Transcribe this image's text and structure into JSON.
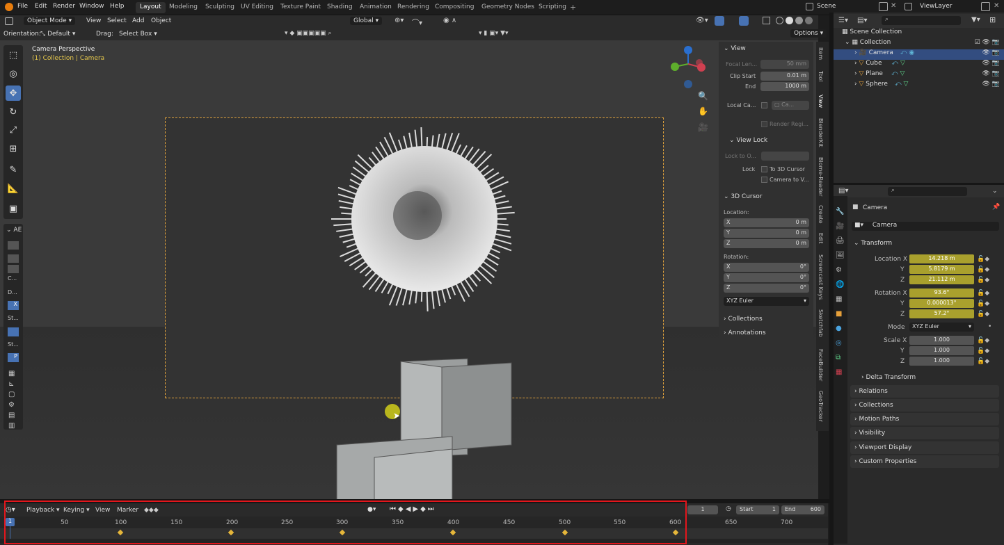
{
  "menubar": {
    "menus": [
      "File",
      "Edit",
      "Render",
      "Window",
      "Help"
    ],
    "workspaces": [
      "Layout",
      "Modeling",
      "Sculpting",
      "UV Editing",
      "Texture Paint",
      "Shading",
      "Animation",
      "Rendering",
      "Compositing",
      "Geometry Nodes",
      "Scripting"
    ],
    "active_workspace": "Layout",
    "scene": "Scene",
    "view_layer": "ViewLayer"
  },
  "viewport_header": {
    "mode": "Object Mode",
    "menus": [
      "View",
      "Select",
      "Add",
      "Object"
    ],
    "transform": "Global",
    "orientation_label": "Orientation:",
    "orientation_value": "Default",
    "drag_label": "Drag:",
    "drag_value": "Select Box",
    "options": "Options"
  },
  "viewport": {
    "title": "Camera Perspective",
    "subtitle": "(1) Collection | Camera",
    "ae_label": "AE",
    "side_labels": [
      "C...",
      "D...",
      "X",
      "St...",
      "St...",
      "P"
    ]
  },
  "npanel": {
    "view_section": "View",
    "focal_label": "Focal Len...",
    "focal_value": "50 mm",
    "clip_start_label": "Clip Start",
    "clip_start_value": "0.01 m",
    "end_label": "End",
    "end_value": "1000 m",
    "local_cam_label": "Local Ca...",
    "local_cam_value": "Ca...",
    "render_region": "Render Regi...",
    "view_lock": "View Lock",
    "lock_to_label": "Lock to O...",
    "lock_label": "Lock",
    "to_3d_cursor": "To 3D Cursor",
    "camera_to_view": "Camera to V...",
    "cursor_section": "3D Cursor",
    "location_label": "Location:",
    "loc": [
      {
        "axis": "X",
        "value": "0 m"
      },
      {
        "axis": "Y",
        "value": "0 m"
      },
      {
        "axis": "Z",
        "value": "0 m"
      }
    ],
    "rotation_label": "Rotation:",
    "rot": [
      {
        "axis": "X",
        "value": "0°"
      },
      {
        "axis": "Y",
        "value": "0°"
      },
      {
        "axis": "Z",
        "value": "0°"
      }
    ],
    "rot_mode": "XYZ Euler",
    "collections": "Collections",
    "annotations": "Annotations"
  },
  "vertical_tabs": [
    "Item",
    "Tool",
    "View",
    "BlenderKit",
    "Blome-Reader",
    "Create",
    "Edit",
    "Screencast Keys",
    "Sketchfab",
    "FaceBuilder",
    "GeoTracker"
  ],
  "outliner": {
    "scene_collection": "Scene Collection",
    "collection": "Collection",
    "items": [
      "Camera",
      "Cube",
      "Plane",
      "Sphere"
    ]
  },
  "properties": {
    "object_name": "Camera",
    "data_name": "Camera",
    "transform": "Transform",
    "location_x_label": "Location X",
    "location": [
      "14.218 m",
      "5.8179 m",
      "21.112 m"
    ],
    "rotation_x_label": "Rotation X",
    "rotation": [
      "93.6°",
      "0.000013°",
      "57.2°"
    ],
    "mode_label": "Mode",
    "mode_value": "XYZ Euler",
    "scale_x_label": "Scale X",
    "scale": [
      "1.000",
      "1.000",
      "1.000"
    ],
    "y_label": "Y",
    "z_label": "Z",
    "delta": "Delta Transform",
    "sections": [
      "Relations",
      "Collections",
      "Motion Paths",
      "Visibility",
      "Viewport Display",
      "Custom Properties"
    ]
  },
  "timeline": {
    "menus": [
      "Playback",
      "Keying",
      "View",
      "Marker"
    ],
    "current_frame": "1",
    "start_label": "Start",
    "start_value": "1",
    "end_label": "End",
    "end_value": "600",
    "ticks": [
      "50",
      "100",
      "150",
      "200",
      "250",
      "300",
      "350",
      "400",
      "450",
      "500",
      "550",
      "600",
      "650",
      "700"
    ],
    "playhead": "1"
  }
}
